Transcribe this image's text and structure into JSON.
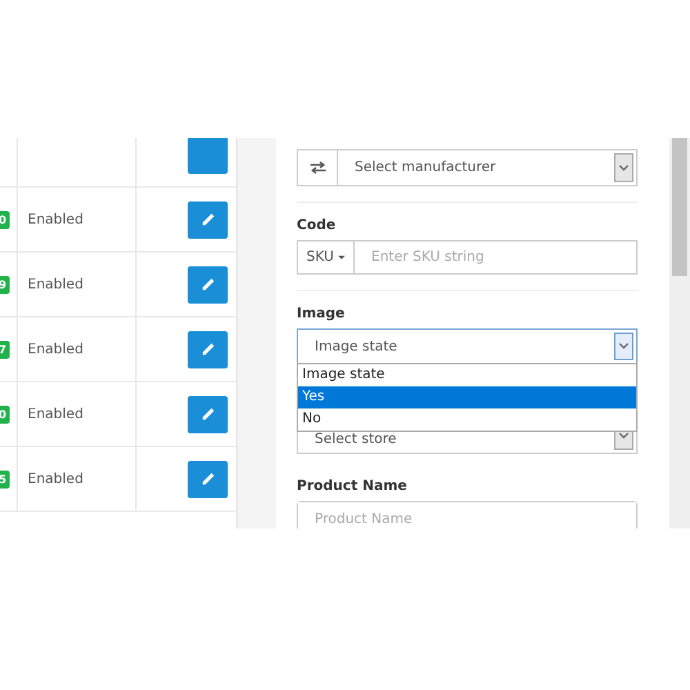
{
  "table": {
    "rows": [
      {
        "badge": "0",
        "status": "Enabled"
      },
      {
        "badge": "9",
        "status": "Enabled"
      },
      {
        "badge": "7",
        "status": "Enabled"
      },
      {
        "badge": "0",
        "status": "Enabled"
      },
      {
        "badge": "5",
        "status": "Enabled"
      }
    ]
  },
  "form": {
    "manufacturer": {
      "value": "Select manufacturer"
    },
    "code": {
      "label": "Code",
      "addon": "SKU",
      "placeholder": "Enter SKU string"
    },
    "image": {
      "label": "Image",
      "value": "Image state",
      "options": [
        {
          "label": "Image state",
          "highlighted": false
        },
        {
          "label": "Yes",
          "highlighted": true
        },
        {
          "label": "No",
          "highlighted": false
        }
      ]
    },
    "store": {
      "value": "Select store"
    },
    "product_name": {
      "label": "Product Name",
      "placeholder": "Product Name"
    }
  }
}
